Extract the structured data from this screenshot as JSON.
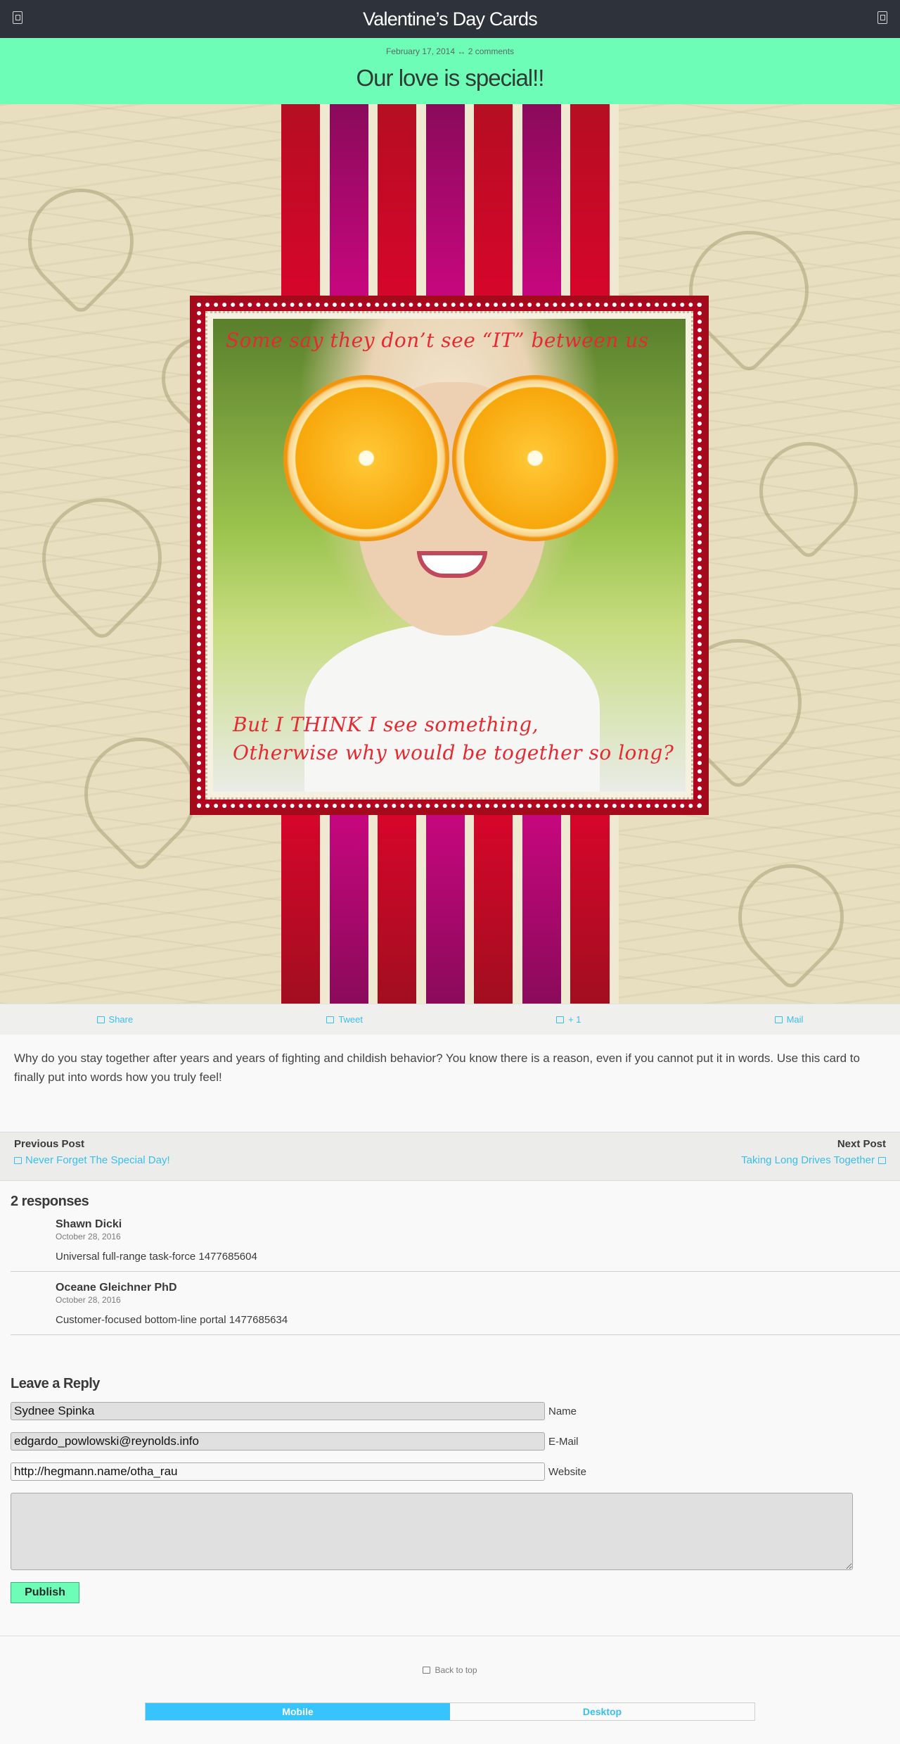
{
  "header": {
    "title": "Valentine’s Day Cards",
    "left_icon": "menu-icon",
    "right_icon": "sidebar-icon"
  },
  "post": {
    "date": "February 17, 2014",
    "separator": "↔",
    "comments_link": "2 comments",
    "title": "Our love is special!!"
  },
  "card_image": {
    "text_top": "Some say they don’t see “IT” between us",
    "text_bottom_1": "But I THINK I see something,",
    "text_bottom_2": "Otherwise why would be together so long?"
  },
  "share": [
    {
      "label": "Share",
      "icon": "share-icon"
    },
    {
      "label": "Tweet",
      "icon": "tweet-icon"
    },
    {
      "label": "+ 1",
      "icon": "plus-one-icon"
    },
    {
      "label": "Mail",
      "icon": "mail-icon"
    }
  ],
  "body_text": "Why do you stay together after years and years of fighting and childish behavior? You know there is a reason, even if you cannot put it in words. Use this card to finally put into words how you truly feel!",
  "post_nav": {
    "previous_heading": "Previous Post",
    "previous_link": "Never Forget The Special Day!",
    "next_heading": "Next Post",
    "next_link": "Taking Long Drives Together"
  },
  "responses": {
    "heading": "2 responses",
    "comments": [
      {
        "author": "Shawn Dicki",
        "date": "October 28, 2016",
        "text": "Universal full-range task-force 1477685604"
      },
      {
        "author": "Oceane Gleichner PhD",
        "date": "October 28, 2016",
        "text": "Customer-focused bottom-line portal 1477685634"
      }
    ]
  },
  "reply_form": {
    "heading": "Leave a Reply",
    "name_value": "Sydnee Spinka",
    "name_label": "Name",
    "email_value": "edgardo_powlowski@reynolds.info",
    "email_label": "E-Mail",
    "website_value": "http://hegmann.name/otha_rau",
    "website_label": "Website",
    "comment_value": "",
    "submit_label": "Publish"
  },
  "footer": {
    "back_to_top": "Back to top",
    "mobile_label": "Mobile",
    "desktop_label": "Desktop",
    "active_view": "Mobile"
  },
  "colors": {
    "header_bg": "#2d323b",
    "accent_green": "#6dfdb7",
    "link_blue": "#37bff0"
  }
}
